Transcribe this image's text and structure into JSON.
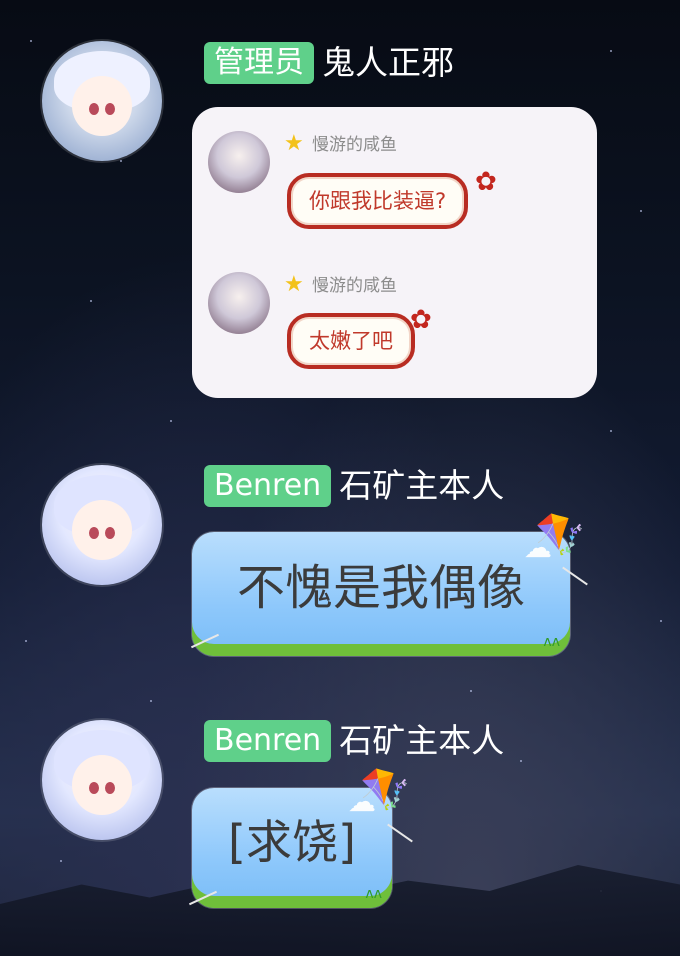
{
  "messages": [
    {
      "badge": "管理员",
      "nickname": "鬼人正邪",
      "quoted": [
        {
          "name": "慢游的咸鱼",
          "text": "你跟我比装逼?"
        },
        {
          "name": "慢游的咸鱼",
          "text": "太嫩了吧"
        }
      ]
    },
    {
      "badge": "Benren",
      "nickname": "石矿主本人",
      "text": "不愧是我偶像"
    },
    {
      "badge": "Benren",
      "nickname": "石矿主本人",
      "text": "[求饶]"
    }
  ],
  "icons": {
    "star": "star-icon",
    "kite": "kite-icon",
    "flower": "flower-icon"
  },
  "colors": {
    "badge": "#5fd08a",
    "quote_border": "#b82c22",
    "bubble_sky": "#8ec8fb",
    "grass": "#6fbf3a"
  }
}
